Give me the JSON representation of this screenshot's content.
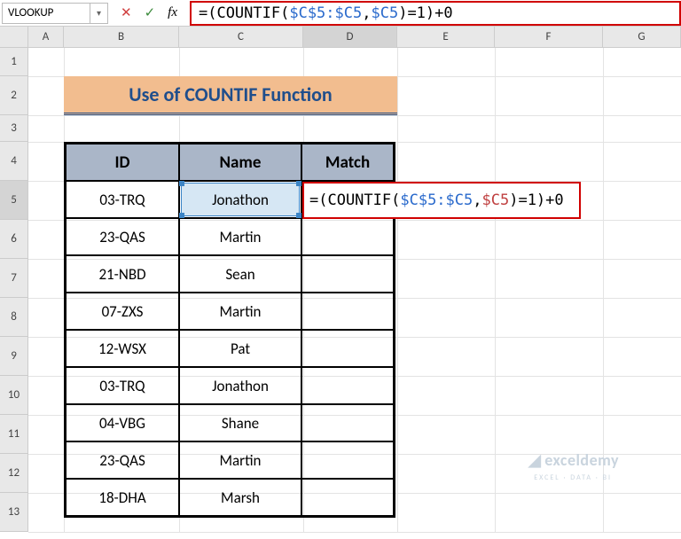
{
  "name_box": "VLOOKUP",
  "formula_bar": {
    "prefix": "=(COUNTIF(",
    "ref1": "$C$5:$C5",
    "comma": ",",
    "ref2": "$C5",
    "suffix": ")=1)+0"
  },
  "title": "Use of COUNTIF Function",
  "headers": {
    "B": "ID",
    "C": "Name",
    "D": "Match"
  },
  "col_letters": {
    "A": "A",
    "B": "B",
    "C": "C",
    "D": "D",
    "E": "E",
    "F": "F",
    "G": "G"
  },
  "row_numbers": [
    "1",
    "2",
    "3",
    "4",
    "5",
    "6",
    "7",
    "8",
    "9",
    "10",
    "11",
    "12",
    "13"
  ],
  "rows": [
    {
      "id": "03-TRQ",
      "name": "Jonathon"
    },
    {
      "id": "23-QAS",
      "name": "Martin"
    },
    {
      "id": "21-NBD",
      "name": "Sean"
    },
    {
      "id": "07-ZXS",
      "name": "Martin"
    },
    {
      "id": "12-WSX",
      "name": "Pat"
    },
    {
      "id": "03-TRQ",
      "name": "Jonathon"
    },
    {
      "id": "04-VBG",
      "name": "Shane"
    },
    {
      "id": "23-QAS",
      "name": "Martin"
    },
    {
      "id": "18-DHA",
      "name": "Marsh"
    }
  ],
  "cell_edit": {
    "prefix": "=(COUNTIF(",
    "ref1": "$C$5:$C5",
    "comma": ",",
    "ref2": "$C5",
    "suffix": ")=1)+0"
  },
  "watermark": {
    "brand": "exceldemy",
    "tag": "EXCEL · DATA · BI"
  },
  "chart_data": {
    "type": "table",
    "title": "Use of COUNTIF Function",
    "columns": [
      "ID",
      "Name",
      "Match"
    ],
    "rows": [
      [
        "03-TRQ",
        "Jonathon",
        "=(COUNTIF($C$5:$C5,$C5)=1)+0"
      ],
      [
        "23-QAS",
        "Martin",
        ""
      ],
      [
        "21-NBD",
        "Sean",
        ""
      ],
      [
        "07-ZXS",
        "Martin",
        ""
      ],
      [
        "12-WSX",
        "Pat",
        ""
      ],
      [
        "03-TRQ",
        "Jonathon",
        ""
      ],
      [
        "04-VBG",
        "Shane",
        ""
      ],
      [
        "23-QAS",
        "Martin",
        ""
      ],
      [
        "18-DHA",
        "Marsh",
        ""
      ]
    ]
  }
}
